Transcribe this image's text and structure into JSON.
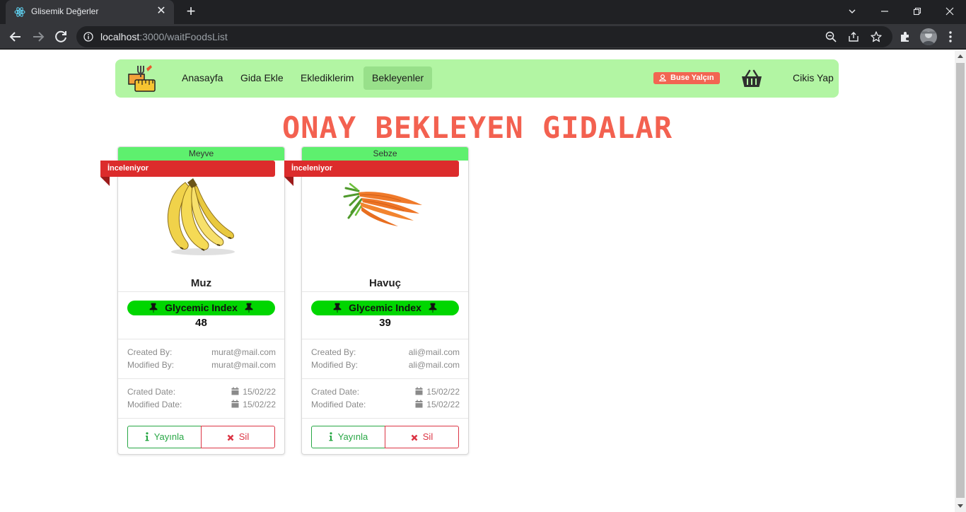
{
  "browser": {
    "tab_title": "Glisemik Değerler",
    "url_host": "localhost",
    "url_path": ":3000/waitFoodsList"
  },
  "navbar": {
    "items": [
      {
        "label": "Anasayfa",
        "active": false
      },
      {
        "label": "Gida Ekle",
        "active": false
      },
      {
        "label": "Eklediklerim",
        "active": false
      },
      {
        "label": "Bekleyenler",
        "active": true
      }
    ],
    "user_name": "Buse Yalçın",
    "logout_label": "Cikis Yap"
  },
  "page": {
    "title": "ONAY BEKLEYEN GIDALAR"
  },
  "cards": [
    {
      "category": "Meyve",
      "status": "İnceleniyor",
      "image": "banana",
      "name": "Muz",
      "gi_label": "Glycemic Index",
      "gi_value": "48",
      "created_by_label": "Created By:",
      "created_by": "murat@mail.com",
      "modified_by_label": "Modified By:",
      "modified_by": "murat@mail.com",
      "created_date_label": "Crated Date:",
      "created_date": "15/02/22",
      "modified_date_label": "Modified Date:",
      "modified_date": "15/02/22",
      "publish_label": "Yayınla",
      "delete_label": "Sil"
    },
    {
      "category": "Sebze",
      "status": "İnceleniyor",
      "image": "carrot",
      "name": "Havuç",
      "gi_label": "Glycemic Index",
      "gi_value": "39",
      "created_by_label": "Created By:",
      "created_by": "ali@mail.com",
      "modified_by_label": "Modified By:",
      "modified_by": "ali@mail.com",
      "created_date_label": "Crated Date:",
      "created_date": "15/02/22",
      "modified_date_label": "Modified Date:",
      "modified_date": "15/02/22",
      "publish_label": "Yayınla",
      "delete_label": "Sil"
    }
  ],
  "colors": {
    "navbar_bg": "#b2f5a3",
    "title": "#f36150",
    "category_header": "#5ef06e",
    "ribbon": "#dc2c2c",
    "gi_bar": "#00d600",
    "publish": "#28a745",
    "delete": "#dc3545",
    "user_badge": "#f26552"
  }
}
